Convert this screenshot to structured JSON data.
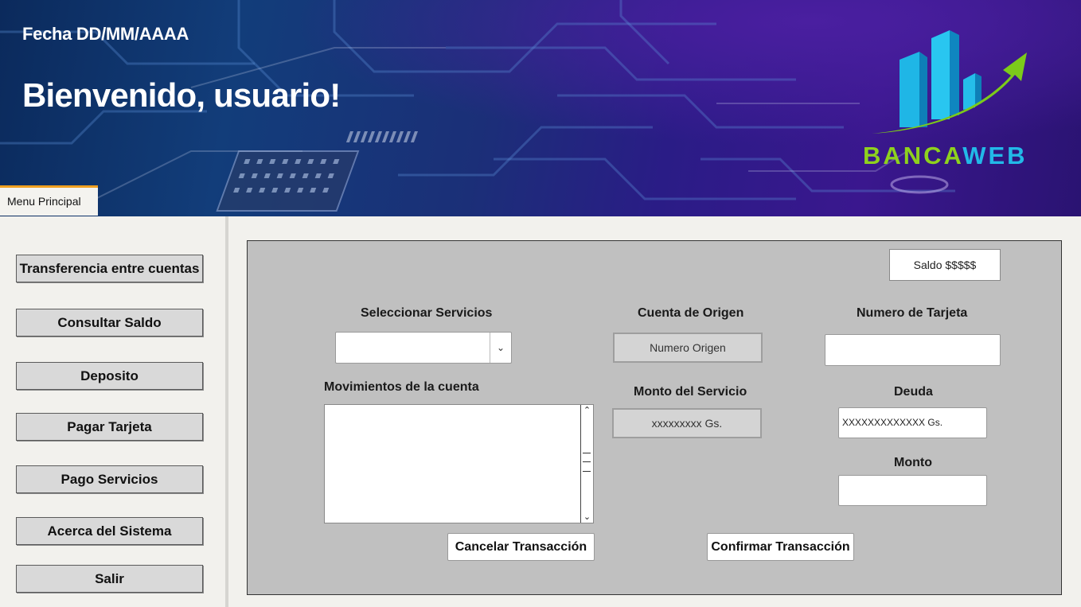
{
  "header": {
    "date": "Fecha DD/MM/AAAA",
    "welcome": "Bienvenido, usuario!",
    "logo_part1": "BANCA",
    "logo_part2": "WEB"
  },
  "tab": {
    "label": "Menu Principal"
  },
  "sidebar": {
    "items": [
      {
        "label": "Transferencia entre cuentas"
      },
      {
        "label": "Consultar Saldo"
      },
      {
        "label": "Deposito"
      },
      {
        "label": "Pagar Tarjeta"
      },
      {
        "label": "Pago Servicios"
      },
      {
        "label": "Acerca del Sistema"
      },
      {
        "label": "Salir"
      }
    ]
  },
  "form": {
    "saldo": "Saldo $$$$$",
    "services_label": "Seleccionar Servicios",
    "services_value": "",
    "origin_label": "Cuenta de Origen",
    "origin_value": "Numero Origen",
    "card_label": "Numero de Tarjeta",
    "card_value": "",
    "movements_label": "Movimientos de la cuenta",
    "amount_service_label": "Monto del Servicio",
    "amount_service_value": "xxxxxxxxx Gs.",
    "debt_label": "Deuda",
    "debt_value": "XXXXXXXXXXXXX Gs.",
    "amount_label": "Monto",
    "amount_value": "",
    "cancel_label": "Cancelar Transacción",
    "confirm_label": "Confirmar Transacción"
  },
  "colors": {
    "tab_accent": "#f0a020",
    "logo_green": "#8ed11e",
    "logo_blue": "#22b9e8"
  }
}
